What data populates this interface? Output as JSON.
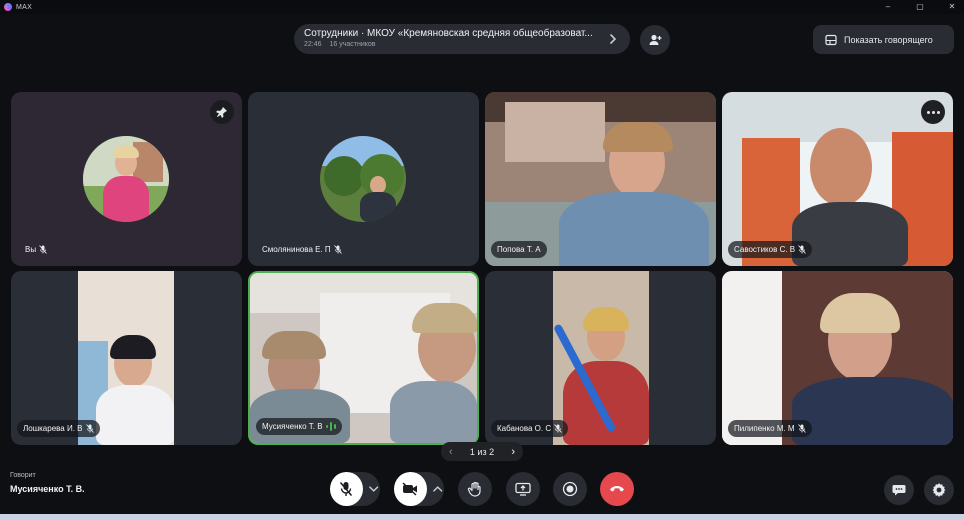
{
  "window": {
    "app_name": "MAX",
    "minimize": "–",
    "maximize": "▢",
    "close": "✕"
  },
  "header": {
    "chat_title": "Сотрудники · МКОУ «Кремяновская средняя общеобразоват...",
    "time": "22:46",
    "participants": "16 участников",
    "show_speaker_label": "Показать говорящего"
  },
  "tiles": [
    {
      "name": "Вы",
      "type": "avatar"
    },
    {
      "name": "Смолянинова Е. П",
      "type": "avatar"
    },
    {
      "name": "Попова Т. А",
      "type": "video"
    },
    {
      "name": "Савостиков С. В",
      "type": "video"
    },
    {
      "name": "Лошкарева И. В",
      "type": "video"
    },
    {
      "name": "Мусияченко Т. В",
      "type": "video",
      "speaking": true
    },
    {
      "name": "Кабанова О. С",
      "type": "video"
    },
    {
      "name": "Пилипенко М. М",
      "type": "video"
    }
  ],
  "pager": {
    "label": "1 из 2",
    "prev": "‹",
    "next": "›"
  },
  "speaking": {
    "label": "Говорит",
    "name": "Мусияченко Т. В."
  },
  "colors": {
    "accent_green": "#4caf50",
    "end_call_red": "#e5484d",
    "panel": "#2a2c33"
  }
}
